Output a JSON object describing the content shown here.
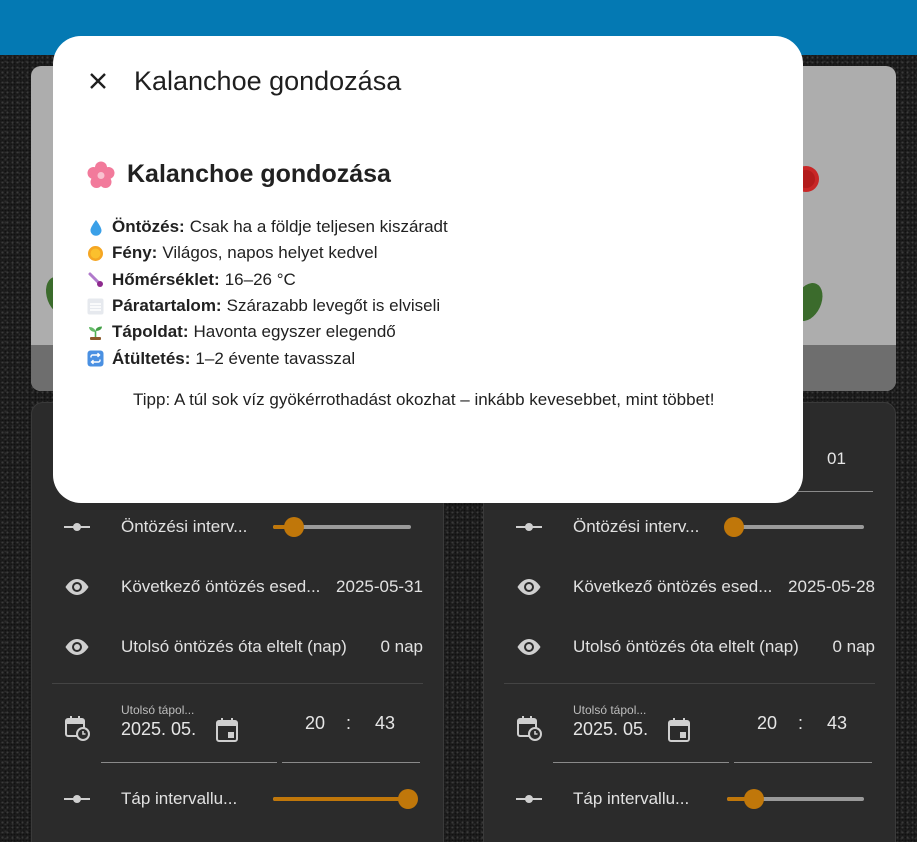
{
  "dialog": {
    "title": "Kalanchoe gondozása",
    "heading": "Kalanchoe gondozása",
    "care_items": [
      {
        "icon": "droplet-icon",
        "label": "Öntözés:",
        "text": "Csak ha a földje teljesen kiszáradt"
      },
      {
        "icon": "sun-icon",
        "label": "Fény:",
        "text": "Világos, napos helyet kedvel"
      },
      {
        "icon": "thermometer-icon",
        "label": "Hőmérséklet:",
        "text": "16–26 °C"
      },
      {
        "icon": "fog-icon",
        "label": "Páratartalom:",
        "text": "Szárazabb levegőt is elviseli"
      },
      {
        "icon": "seedling-icon",
        "label": "Tápoldat:",
        "text": "Havonta egyszer elegendő"
      },
      {
        "icon": "repeat-icon",
        "label": "Átültetés:",
        "text": "1–2 évente tavasszal"
      }
    ],
    "tip": "Tipp: A túl sok víz gyökérrothadást okozhat – inkább kevesebbet, mint többet!"
  },
  "cards": {
    "left": {
      "watering_interval_label": "Öntözési interv...",
      "watering_interval_level": 0.15,
      "next_watering_label": "Következő öntözés esed...",
      "next_watering_value": "2025-05-31",
      "since_last_label": "Utolsó öntözés óta eltelt (nap)",
      "since_last_value": "0 nap",
      "last_feed_small": "Utolsó tápol...",
      "last_feed_date": "2025. 05.",
      "time_hour": "20",
      "time_sep": ":",
      "time_minute": "43",
      "feed_interval_label": "Táp intervallu...",
      "feed_interval_level": 1.0
    },
    "right": {
      "top_field_value": "01",
      "watering_interval_label": "Öntözési interv...",
      "watering_interval_level": 0.0,
      "next_watering_label": "Következő öntözés esed...",
      "next_watering_value": "2025-05-28",
      "since_last_label": "Utolsó öntözés óta eltelt (nap)",
      "since_last_value": "0 nap",
      "last_feed_small": "Utolsó tápol...",
      "last_feed_date": "2025. 05.",
      "time_hour": "20",
      "time_sep": ":",
      "time_minute": "43",
      "feed_interval_label": "Táp intervallu...",
      "feed_interval_level": 0.2
    }
  },
  "colors": {
    "topbar": "#0479b3",
    "accent": "#c0770a",
    "card_bg": "#2b2b2b"
  }
}
